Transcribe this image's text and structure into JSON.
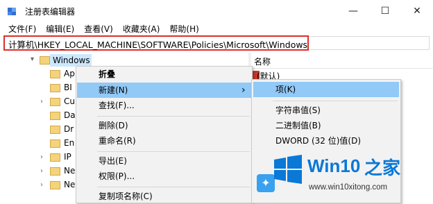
{
  "window": {
    "title": "注册表编辑器",
    "min_glyph": "—",
    "max_glyph": "☐",
    "close_glyph": "✕"
  },
  "menubar": [
    "文件(F)",
    "编辑(E)",
    "查看(V)",
    "收藏夹(A)",
    "帮助(H)"
  ],
  "address": "计算机\\HKEY_LOCAL_MACHINE\\SOFTWARE\\Policies\\Microsoft\\Windows",
  "tree": {
    "selected": "Windows",
    "children": [
      "Ap",
      "BI",
      "Cu",
      "Da",
      "Dr",
      "En",
      "IP",
      "Ne",
      "Ne"
    ]
  },
  "right_pane": {
    "column_name": "名称",
    "default_value": "(默认)"
  },
  "context_menu": {
    "items": [
      "折叠",
      "新建(N)",
      "查找(F)...",
      "删除(D)",
      "重命名(R)",
      "导出(E)",
      "权限(P)...",
      "复制项名称(C)"
    ],
    "arrow": "›"
  },
  "submenu": {
    "items": [
      "项(K)",
      "字符串值(S)",
      "二进制值(B)",
      "DWORD (32 位)值(D)"
    ]
  },
  "watermark": {
    "brand": "Win10",
    "brand_suffix": "之家",
    "url": "www.win10xitong.com"
  },
  "colors": {
    "highlight": "#91c9f7",
    "address_border": "#d9302a",
    "win_blue": "#0a78d7"
  }
}
